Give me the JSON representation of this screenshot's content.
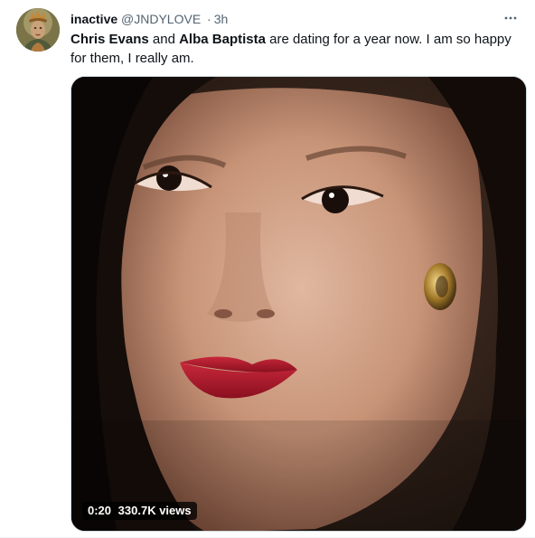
{
  "tweet": {
    "display_name": "inactive",
    "handle": "@JNDYLOVE",
    "separator": "·",
    "time": "3h",
    "more_icon": "ellipsis-icon",
    "text_parts": {
      "name1": "Chris Evans",
      "and": " and ",
      "name2": "Alba Baptista",
      "rest": " are dating for a year now. I am so happy for them, I really am."
    },
    "media": {
      "duration": "0:20",
      "views": "330.7K views",
      "play_state": "video-thumbnail"
    },
    "colors": {
      "text": "#0f1419",
      "secondary": "#536471",
      "badge_bg": "rgba(0,0,0,0.77)"
    }
  }
}
